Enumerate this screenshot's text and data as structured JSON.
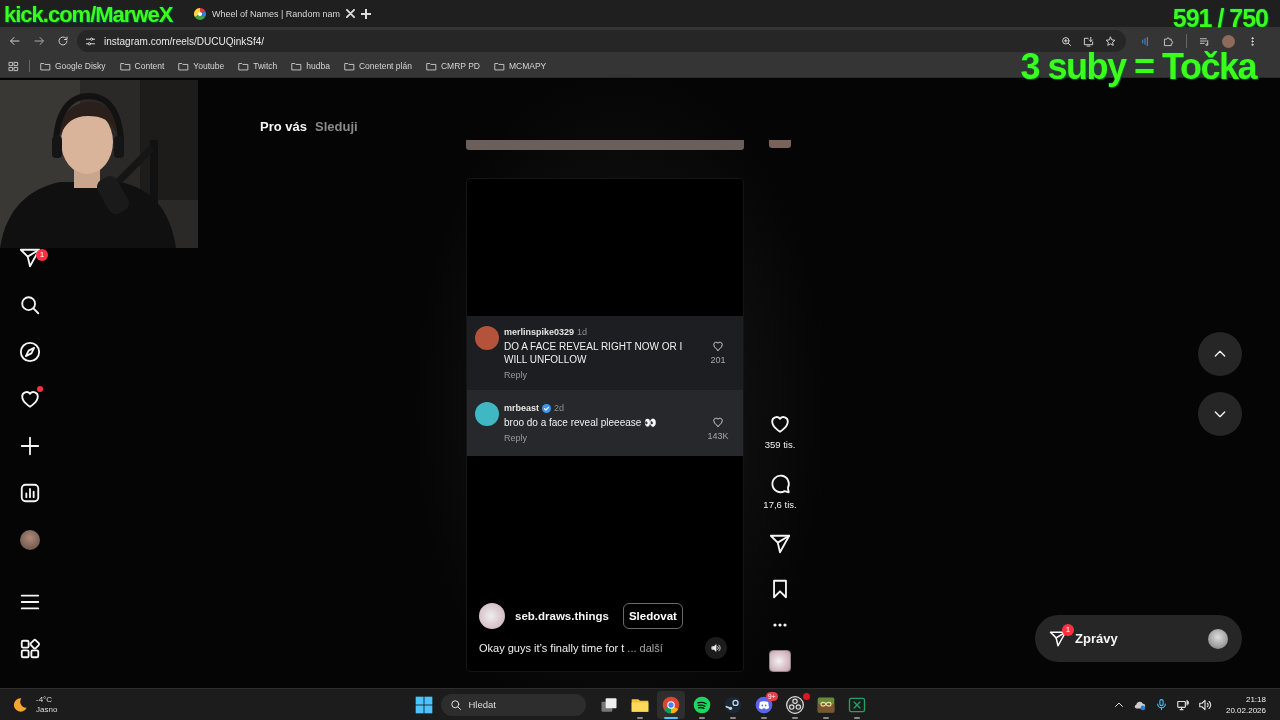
{
  "stream_overlay": {
    "channel": "kick.com/MarweX",
    "counter": "591 / 750",
    "goal": "3 suby = Točka"
  },
  "browser": {
    "tabs": [
      {
        "title": "Wheel of Names | Random nam",
        "selected": false
      }
    ],
    "address": "instagram.com/reels/DUCUQinkSf4/",
    "bookmarks": [
      "Google Disky",
      "Content",
      "Youtube",
      "Twitch",
      "hudba",
      "Conetent plán",
      "CMRP PD",
      "MCMAPY"
    ]
  },
  "sidebar": {
    "items": [
      {
        "kind": "messages",
        "badge": "1"
      },
      {
        "kind": "search"
      },
      {
        "kind": "explore"
      },
      {
        "kind": "notifications",
        "alert": true
      },
      {
        "kind": "create"
      },
      {
        "kind": "dashboard"
      },
      {
        "kind": "profile"
      }
    ],
    "bottom_items": [
      {
        "kind": "menu"
      },
      {
        "kind": "apps"
      }
    ]
  },
  "feed_tabs": [
    {
      "label": "Pro vás",
      "selected": true
    },
    {
      "label": "Sleduji",
      "selected": false
    }
  ],
  "reel": {
    "comments": [
      {
        "user": "merlinspike0329",
        "time": "1d",
        "verified": false,
        "color": "#b5523a",
        "text": "DO A FACE REVEAL RIGHT NOW OR I WILL UNFOLLOW",
        "likes": "201",
        "reply": "Reply",
        "highlighted": false
      },
      {
        "user": "mrbeast",
        "time": "2d",
        "verified": true,
        "color": "#3fb8c4",
        "text": "broo do a face reveal pleeease 👀",
        "likes": "143K",
        "reply": "Reply",
        "highlighted": true
      }
    ],
    "author": "seb.draws.things",
    "follow": "Sledovat",
    "caption": "Okay guys it’s finally time for t",
    "more": "... další"
  },
  "actions": [
    {
      "kind": "like",
      "count": "359 tis."
    },
    {
      "kind": "comment",
      "count": "17,6 tis."
    },
    {
      "kind": "share"
    },
    {
      "kind": "save"
    },
    {
      "kind": "more"
    },
    {
      "kind": "audio"
    }
  ],
  "messages": {
    "label": "Zprávy",
    "badge": "1"
  },
  "taskbar": {
    "weather": {
      "temperature": "-4°C",
      "condition": "Jasno"
    },
    "search": "Hledat",
    "apps": [
      {
        "kind": "start"
      },
      {
        "kind": "taskview"
      },
      {
        "kind": "explorer",
        "running": true,
        "active": false
      },
      {
        "kind": "chrome",
        "running": true,
        "active": true
      },
      {
        "kind": "spotify",
        "running": true,
        "active": false
      },
      {
        "kind": "steam",
        "running": true,
        "active": false
      },
      {
        "kind": "discord",
        "running": true,
        "active": false,
        "badge": "9+"
      },
      {
        "kind": "obs",
        "running": true,
        "active": false,
        "alert": true
      },
      {
        "kind": "minecraft",
        "running": true,
        "active": false
      },
      {
        "kind": "excel",
        "running": true,
        "active": false
      }
    ],
    "time": "21:18",
    "date": "20.02.2026"
  }
}
